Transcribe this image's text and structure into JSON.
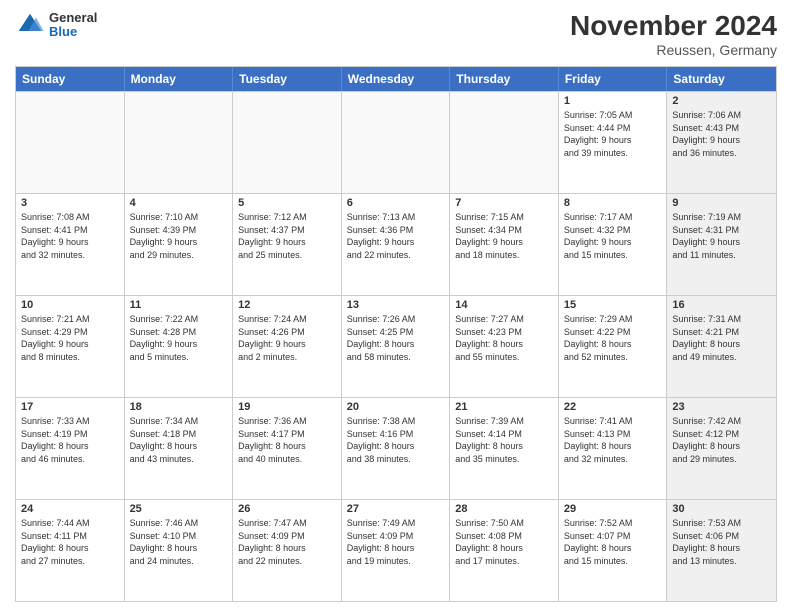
{
  "header": {
    "logo": {
      "general": "General",
      "blue": "Blue"
    },
    "title": "November 2024",
    "location": "Reussen, Germany"
  },
  "calendar": {
    "headers": [
      "Sunday",
      "Monday",
      "Tuesday",
      "Wednesday",
      "Thursday",
      "Friday",
      "Saturday"
    ],
    "rows": [
      [
        {
          "day": "",
          "info": "",
          "empty": true
        },
        {
          "day": "",
          "info": "",
          "empty": true
        },
        {
          "day": "",
          "info": "",
          "empty": true
        },
        {
          "day": "",
          "info": "",
          "empty": true
        },
        {
          "day": "",
          "info": "",
          "empty": true
        },
        {
          "day": "1",
          "info": "Sunrise: 7:05 AM\nSunset: 4:44 PM\nDaylight: 9 hours\nand 39 minutes.",
          "empty": false,
          "shaded": false
        },
        {
          "day": "2",
          "info": "Sunrise: 7:06 AM\nSunset: 4:43 PM\nDaylight: 9 hours\nand 36 minutes.",
          "empty": false,
          "shaded": true
        }
      ],
      [
        {
          "day": "3",
          "info": "Sunrise: 7:08 AM\nSunset: 4:41 PM\nDaylight: 9 hours\nand 32 minutes.",
          "empty": false,
          "shaded": false
        },
        {
          "day": "4",
          "info": "Sunrise: 7:10 AM\nSunset: 4:39 PM\nDaylight: 9 hours\nand 29 minutes.",
          "empty": false,
          "shaded": false
        },
        {
          "day": "5",
          "info": "Sunrise: 7:12 AM\nSunset: 4:37 PM\nDaylight: 9 hours\nand 25 minutes.",
          "empty": false,
          "shaded": false
        },
        {
          "day": "6",
          "info": "Sunrise: 7:13 AM\nSunset: 4:36 PM\nDaylight: 9 hours\nand 22 minutes.",
          "empty": false,
          "shaded": false
        },
        {
          "day": "7",
          "info": "Sunrise: 7:15 AM\nSunset: 4:34 PM\nDaylight: 9 hours\nand 18 minutes.",
          "empty": false,
          "shaded": false
        },
        {
          "day": "8",
          "info": "Sunrise: 7:17 AM\nSunset: 4:32 PM\nDaylight: 9 hours\nand 15 minutes.",
          "empty": false,
          "shaded": false
        },
        {
          "day": "9",
          "info": "Sunrise: 7:19 AM\nSunset: 4:31 PM\nDaylight: 9 hours\nand 11 minutes.",
          "empty": false,
          "shaded": true
        }
      ],
      [
        {
          "day": "10",
          "info": "Sunrise: 7:21 AM\nSunset: 4:29 PM\nDaylight: 9 hours\nand 8 minutes.",
          "empty": false,
          "shaded": false
        },
        {
          "day": "11",
          "info": "Sunrise: 7:22 AM\nSunset: 4:28 PM\nDaylight: 9 hours\nand 5 minutes.",
          "empty": false,
          "shaded": false
        },
        {
          "day": "12",
          "info": "Sunrise: 7:24 AM\nSunset: 4:26 PM\nDaylight: 9 hours\nand 2 minutes.",
          "empty": false,
          "shaded": false
        },
        {
          "day": "13",
          "info": "Sunrise: 7:26 AM\nSunset: 4:25 PM\nDaylight: 8 hours\nand 58 minutes.",
          "empty": false,
          "shaded": false
        },
        {
          "day": "14",
          "info": "Sunrise: 7:27 AM\nSunset: 4:23 PM\nDaylight: 8 hours\nand 55 minutes.",
          "empty": false,
          "shaded": false
        },
        {
          "day": "15",
          "info": "Sunrise: 7:29 AM\nSunset: 4:22 PM\nDaylight: 8 hours\nand 52 minutes.",
          "empty": false,
          "shaded": false
        },
        {
          "day": "16",
          "info": "Sunrise: 7:31 AM\nSunset: 4:21 PM\nDaylight: 8 hours\nand 49 minutes.",
          "empty": false,
          "shaded": true
        }
      ],
      [
        {
          "day": "17",
          "info": "Sunrise: 7:33 AM\nSunset: 4:19 PM\nDaylight: 8 hours\nand 46 minutes.",
          "empty": false,
          "shaded": false
        },
        {
          "day": "18",
          "info": "Sunrise: 7:34 AM\nSunset: 4:18 PM\nDaylight: 8 hours\nand 43 minutes.",
          "empty": false,
          "shaded": false
        },
        {
          "day": "19",
          "info": "Sunrise: 7:36 AM\nSunset: 4:17 PM\nDaylight: 8 hours\nand 40 minutes.",
          "empty": false,
          "shaded": false
        },
        {
          "day": "20",
          "info": "Sunrise: 7:38 AM\nSunset: 4:16 PM\nDaylight: 8 hours\nand 38 minutes.",
          "empty": false,
          "shaded": false
        },
        {
          "day": "21",
          "info": "Sunrise: 7:39 AM\nSunset: 4:14 PM\nDaylight: 8 hours\nand 35 minutes.",
          "empty": false,
          "shaded": false
        },
        {
          "day": "22",
          "info": "Sunrise: 7:41 AM\nSunset: 4:13 PM\nDaylight: 8 hours\nand 32 minutes.",
          "empty": false,
          "shaded": false
        },
        {
          "day": "23",
          "info": "Sunrise: 7:42 AM\nSunset: 4:12 PM\nDaylight: 8 hours\nand 29 minutes.",
          "empty": false,
          "shaded": true
        }
      ],
      [
        {
          "day": "24",
          "info": "Sunrise: 7:44 AM\nSunset: 4:11 PM\nDaylight: 8 hours\nand 27 minutes.",
          "empty": false,
          "shaded": false
        },
        {
          "day": "25",
          "info": "Sunrise: 7:46 AM\nSunset: 4:10 PM\nDaylight: 8 hours\nand 24 minutes.",
          "empty": false,
          "shaded": false
        },
        {
          "day": "26",
          "info": "Sunrise: 7:47 AM\nSunset: 4:09 PM\nDaylight: 8 hours\nand 22 minutes.",
          "empty": false,
          "shaded": false
        },
        {
          "day": "27",
          "info": "Sunrise: 7:49 AM\nSunset: 4:09 PM\nDaylight: 8 hours\nand 19 minutes.",
          "empty": false,
          "shaded": false
        },
        {
          "day": "28",
          "info": "Sunrise: 7:50 AM\nSunset: 4:08 PM\nDaylight: 8 hours\nand 17 minutes.",
          "empty": false,
          "shaded": false
        },
        {
          "day": "29",
          "info": "Sunrise: 7:52 AM\nSunset: 4:07 PM\nDaylight: 8 hours\nand 15 minutes.",
          "empty": false,
          "shaded": false
        },
        {
          "day": "30",
          "info": "Sunrise: 7:53 AM\nSunset: 4:06 PM\nDaylight: 8 hours\nand 13 minutes.",
          "empty": false,
          "shaded": true
        }
      ]
    ]
  }
}
